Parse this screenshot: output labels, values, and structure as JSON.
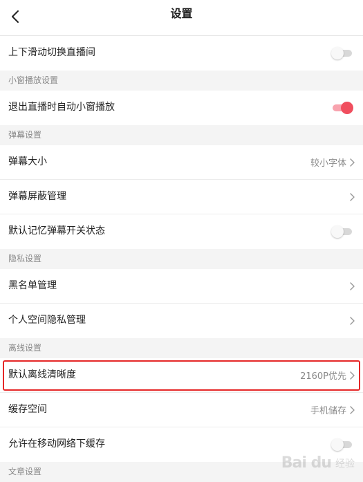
{
  "header": {
    "title": "设置",
    "back_icon": "chevron-left-icon"
  },
  "rows_top": [
    {
      "label": "上下滑动切换直播间",
      "control": "toggle",
      "on": false
    }
  ],
  "sections": [
    {
      "title": "小窗播放设置",
      "rows": [
        {
          "label": "退出直播时自动小窗播放",
          "control": "toggle",
          "on": true
        }
      ]
    },
    {
      "title": "弹幕设置",
      "rows": [
        {
          "label": "弹幕大小",
          "control": "link",
          "value": "较小字体"
        },
        {
          "label": "弹幕屏蔽管理",
          "control": "link",
          "value": ""
        },
        {
          "label": "默认记忆弹幕开关状态",
          "control": "toggle",
          "on": false
        }
      ]
    },
    {
      "title": "隐私设置",
      "rows": [
        {
          "label": "黑名单管理",
          "control": "link",
          "value": ""
        },
        {
          "label": "个人空间隐私管理",
          "control": "link",
          "value": ""
        }
      ]
    },
    {
      "title": "离线设置",
      "rows": [
        {
          "label": "默认离线清晰度",
          "control": "link",
          "value": "2160P优先"
        },
        {
          "label": "缓存空间",
          "control": "link",
          "value": "手机储存"
        },
        {
          "label": "允许在移动网络下缓存",
          "control": "toggle",
          "on": false
        }
      ]
    },
    {
      "title": "文章设置",
      "rows": []
    }
  ],
  "watermark": {
    "text": "Bai du",
    "sub": "经验"
  },
  "colors": {
    "toggle_on": "#f04e5e",
    "toggle_on_track": "#f8a3ae",
    "highlight": "#e52727"
  }
}
